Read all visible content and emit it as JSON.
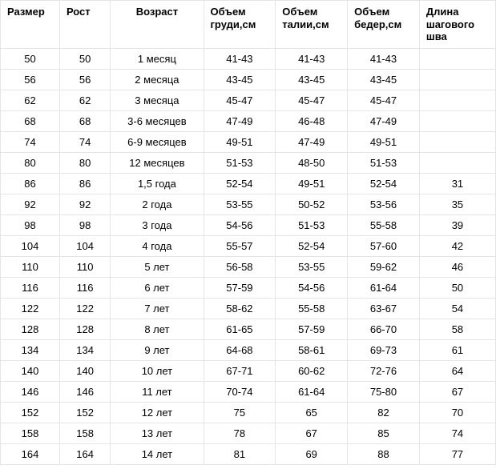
{
  "chart_data": {
    "type": "table",
    "title": "",
    "columns": [
      "Размер",
      "Рост",
      "Возраст",
      "Объем груди,см",
      "Объем талии,см",
      "Объем бедер,см",
      "Длина шагового шва"
    ],
    "rows": [
      [
        "50",
        "50",
        "1 месяц",
        "41-43",
        "41-43",
        "41-43",
        ""
      ],
      [
        "56",
        "56",
        "2 месяца",
        "43-45",
        "43-45",
        "43-45",
        ""
      ],
      [
        "62",
        "62",
        "3 месяца",
        "45-47",
        "45-47",
        "45-47",
        ""
      ],
      [
        "68",
        "68",
        "3-6 месяцев",
        "47-49",
        "46-48",
        "47-49",
        ""
      ],
      [
        "74",
        "74",
        "6-9 месяцев",
        "49-51",
        "47-49",
        "49-51",
        ""
      ],
      [
        "80",
        "80",
        "12 месяцев",
        "51-53",
        "48-50",
        "51-53",
        ""
      ],
      [
        "86",
        "86",
        "1,5 года",
        "52-54",
        "49-51",
        "52-54",
        "31"
      ],
      [
        "92",
        "92",
        "2 года",
        "53-55",
        "50-52",
        "53-56",
        "35"
      ],
      [
        "98",
        "98",
        "3 года",
        "54-56",
        "51-53",
        "55-58",
        "39"
      ],
      [
        "104",
        "104",
        "4 года",
        "55-57",
        "52-54",
        "57-60",
        "42"
      ],
      [
        "110",
        "110",
        "5 лет",
        "56-58",
        "53-55",
        "59-62",
        "46"
      ],
      [
        "116",
        "116",
        "6 лет",
        "57-59",
        "54-56",
        "61-64",
        "50"
      ],
      [
        "122",
        "122",
        "7 лет",
        "58-62",
        "55-58",
        "63-67",
        "54"
      ],
      [
        "128",
        "128",
        "8 лет",
        "61-65",
        "57-59",
        "66-70",
        "58"
      ],
      [
        "134",
        "134",
        "9 лет",
        "64-68",
        "58-61",
        "69-73",
        "61"
      ],
      [
        "140",
        "140",
        "10 лет",
        "67-71",
        "60-62",
        "72-76",
        "64"
      ],
      [
        "146",
        "146",
        "11 лет",
        "70-74",
        "61-64",
        "75-80",
        "67"
      ],
      [
        "152",
        "152",
        "12 лет",
        "75",
        "65",
        "82",
        "70"
      ],
      [
        "158",
        "158",
        "13 лет",
        "78",
        "67",
        "85",
        "74"
      ],
      [
        "164",
        "164",
        "14 лет",
        "81",
        "69",
        "88",
        "77"
      ]
    ]
  }
}
